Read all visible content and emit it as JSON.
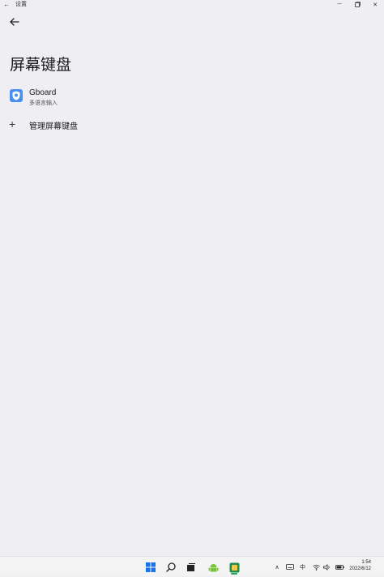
{
  "window": {
    "title": "设置"
  },
  "page": {
    "title": "屏幕键盘"
  },
  "keyboards": [
    {
      "name": "Gboard",
      "subtitle": "多语言输入"
    }
  ],
  "actions": {
    "manage_label": "管理屏幕键盘"
  },
  "tray": {
    "ime": "中"
  },
  "clock": {
    "time": "1:54",
    "date": "2022/6/12"
  },
  "colors": {
    "background": "#efeef3",
    "accent": "#4a8ef0",
    "taskbar": "#f3f3f3"
  },
  "icons": [
    "back-arrow",
    "minimize",
    "restore",
    "close",
    "plus",
    "windows-start",
    "search",
    "task-view",
    "android",
    "app",
    "chevron-up",
    "keyboard",
    "wifi",
    "volume",
    "battery"
  ]
}
